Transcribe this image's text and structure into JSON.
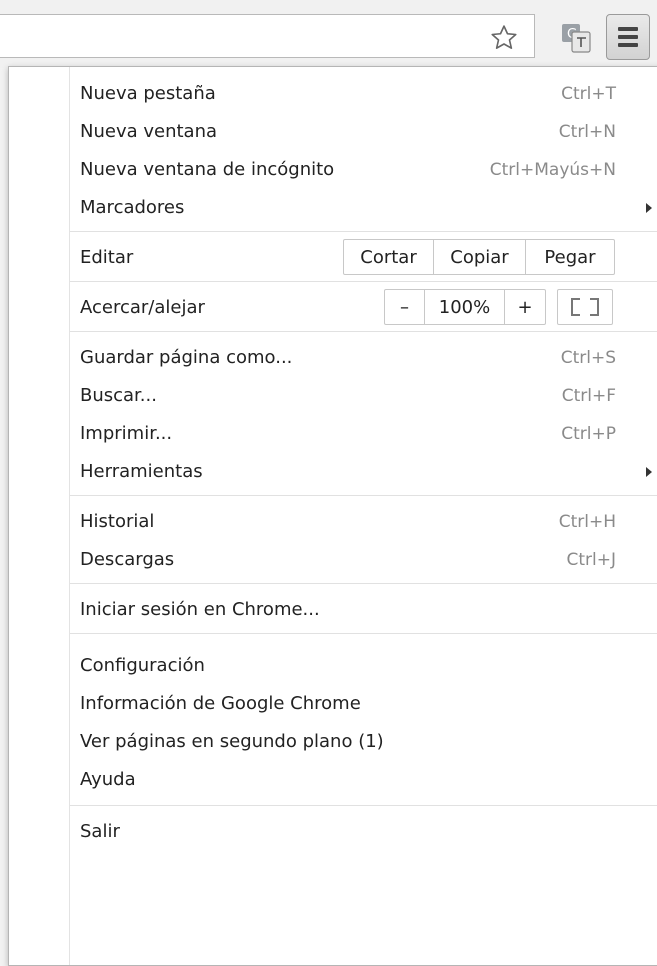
{
  "toolbar": {
    "star_icon": "star-outline-icon",
    "extension_icon": "page-translate-icon",
    "menu_icon": "hamburger-menu-icon"
  },
  "menu": {
    "new_tab": {
      "label": "Nueva pestaña",
      "shortcut": "Ctrl+T"
    },
    "new_window": {
      "label": "Nueva ventana",
      "shortcut": "Ctrl+N"
    },
    "incognito": {
      "label": "Nueva ventana de incógnito",
      "shortcut": "Ctrl+Mayús+N"
    },
    "bookmarks": {
      "label": "Marcadores"
    },
    "edit": {
      "label": "Editar",
      "cut": "Cortar",
      "copy": "Copiar",
      "paste": "Pegar"
    },
    "zoom": {
      "label": "Acercar/alejar",
      "minus": "–",
      "value": "100%",
      "plus": "+"
    },
    "save_as": {
      "label": "Guardar página como...",
      "shortcut": "Ctrl+S"
    },
    "find": {
      "label": "Buscar...",
      "shortcut": "Ctrl+F"
    },
    "print": {
      "label": "Imprimir...",
      "shortcut": "Ctrl+P"
    },
    "tools": {
      "label": "Herramientas"
    },
    "history": {
      "label": "Historial",
      "shortcut": "Ctrl+H"
    },
    "downloads": {
      "label": "Descargas",
      "shortcut": "Ctrl+J"
    },
    "sign_in": {
      "label": "Iniciar sesión en Chrome..."
    },
    "settings": {
      "label": "Configuración"
    },
    "about": {
      "label": "Información de Google Chrome"
    },
    "background_pages": {
      "label": "Ver páginas en segundo plano (1)"
    },
    "help": {
      "label": "Ayuda"
    },
    "exit": {
      "label": "Salir"
    }
  }
}
